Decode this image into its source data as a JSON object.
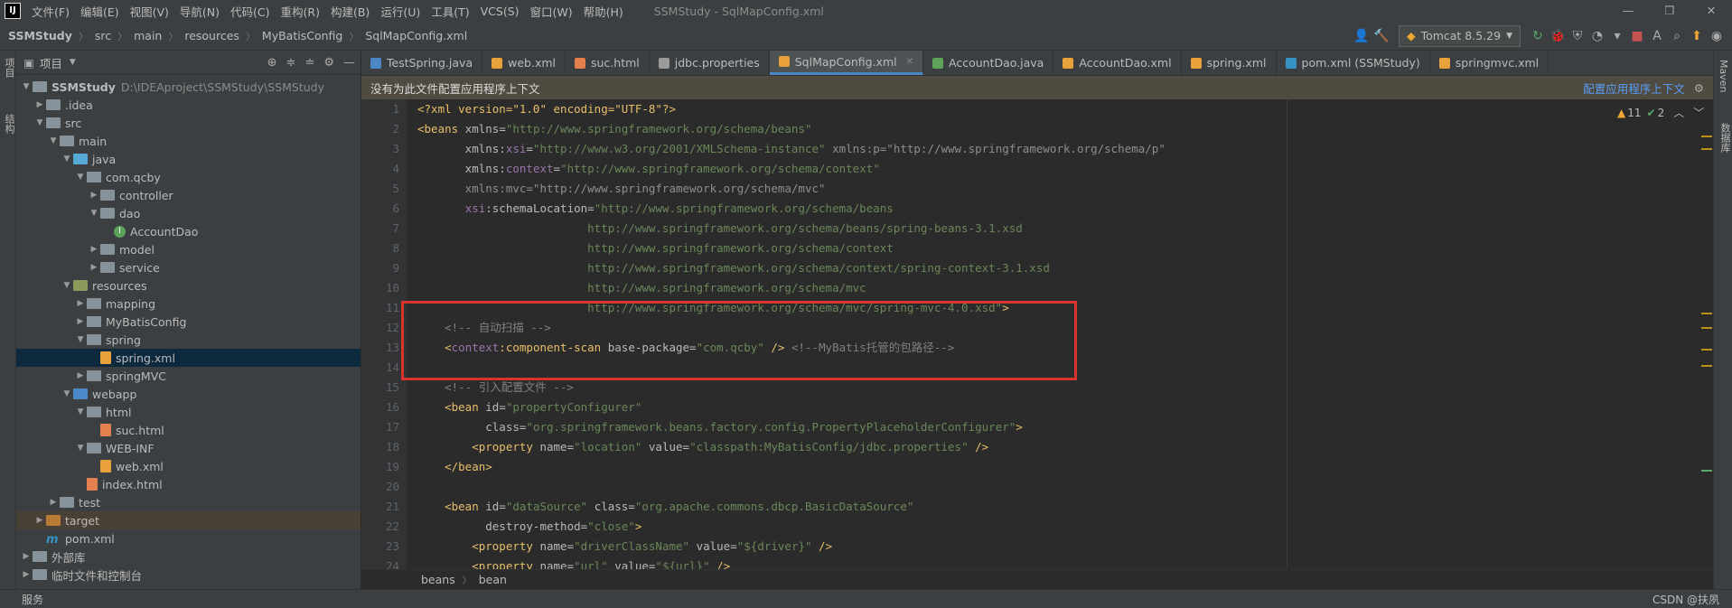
{
  "menubar": {
    "logo": "IJ",
    "items": [
      "文件(F)",
      "编辑(E)",
      "视图(V)",
      "导航(N)",
      "代码(C)",
      "重构(R)",
      "构建(B)",
      "运行(U)",
      "工具(T)",
      "VCS(S)",
      "窗口(W)",
      "帮助(H)"
    ],
    "window_title": "SSMStudy - SqlMapConfig.xml"
  },
  "navbar": {
    "crumbs": [
      "SSMStudy",
      "src",
      "main",
      "resources",
      "MyBatisConfig",
      "SqlMapConfig.xml"
    ],
    "run_config": "Tomcat 8.5.29"
  },
  "left_strip": {
    "project_label": "项目",
    "structure_label": "结构"
  },
  "right_strip": {
    "maven_label": "Maven",
    "db_label": "数据库"
  },
  "project_panel": {
    "title": "项目",
    "tree": [
      {
        "level": 0,
        "arrow": "down",
        "icon": "module",
        "label": "SSMStudy",
        "bold": true,
        "extra": "D:\\IDEAproject\\SSMStudy\\SSMStudy"
      },
      {
        "level": 1,
        "arrow": "right",
        "icon": "folder",
        "label": ".idea"
      },
      {
        "level": 1,
        "arrow": "down",
        "icon": "folder",
        "label": "src"
      },
      {
        "level": 2,
        "arrow": "down",
        "icon": "folder",
        "label": "main"
      },
      {
        "level": 3,
        "arrow": "down",
        "icon": "folder-blue",
        "label": "java"
      },
      {
        "level": 4,
        "arrow": "down",
        "icon": "folder",
        "label": "com.qcby"
      },
      {
        "level": 5,
        "arrow": "right",
        "icon": "folder",
        "label": "controller"
      },
      {
        "level": 5,
        "arrow": "down",
        "icon": "folder",
        "label": "dao"
      },
      {
        "level": 6,
        "arrow": "",
        "icon": "interface",
        "label": "AccountDao"
      },
      {
        "level": 5,
        "arrow": "right",
        "icon": "folder",
        "label": "model"
      },
      {
        "level": 5,
        "arrow": "right",
        "icon": "folder",
        "label": "service"
      },
      {
        "level": 3,
        "arrow": "down",
        "icon": "folder-res",
        "label": "resources"
      },
      {
        "level": 4,
        "arrow": "right",
        "icon": "folder",
        "label": "mapping"
      },
      {
        "level": 4,
        "arrow": "right",
        "icon": "folder",
        "label": "MyBatisConfig"
      },
      {
        "level": 4,
        "arrow": "down",
        "icon": "folder",
        "label": "spring"
      },
      {
        "level": 5,
        "arrow": "",
        "icon": "xml",
        "label": "spring.xml",
        "selected": true
      },
      {
        "level": 4,
        "arrow": "right",
        "icon": "folder",
        "label": "springMVC"
      },
      {
        "level": 3,
        "arrow": "down",
        "icon": "folder-web",
        "label": "webapp"
      },
      {
        "level": 4,
        "arrow": "down",
        "icon": "folder",
        "label": "html"
      },
      {
        "level": 5,
        "arrow": "",
        "icon": "html",
        "label": "suc.html"
      },
      {
        "level": 4,
        "arrow": "down",
        "icon": "folder",
        "label": "WEB-INF"
      },
      {
        "level": 5,
        "arrow": "",
        "icon": "xml",
        "label": "web.xml"
      },
      {
        "level": 4,
        "arrow": "",
        "icon": "html",
        "label": "index.html"
      },
      {
        "level": 2,
        "arrow": "right",
        "icon": "folder",
        "label": "test"
      },
      {
        "level": 1,
        "arrow": "right",
        "icon": "folder-orange",
        "label": "target",
        "excluded": true
      },
      {
        "level": 1,
        "arrow": "",
        "icon": "maven",
        "label": "pom.xml"
      },
      {
        "level": 0,
        "arrow": "right",
        "icon": "lib",
        "label": "外部库"
      },
      {
        "level": 0,
        "arrow": "right",
        "icon": "scratch",
        "label": "临时文件和控制台"
      }
    ]
  },
  "tabs": [
    {
      "label": "TestSpring.java",
      "color": "#4a88c7"
    },
    {
      "label": "web.xml",
      "color": "#e8a13b"
    },
    {
      "label": "suc.html",
      "color": "#e4804d"
    },
    {
      "label": "jdbc.properties",
      "color": "#9a9a9a"
    },
    {
      "label": "SqlMapConfig.xml",
      "color": "#e8a13b",
      "active": true
    },
    {
      "label": "AccountDao.java",
      "color": "#5da35a"
    },
    {
      "label": "AccountDao.xml",
      "color": "#e8a13b"
    },
    {
      "label": "spring.xml",
      "color": "#e8a13b"
    },
    {
      "label": "pom.xml (SSMStudy)",
      "color": "#3592c4"
    },
    {
      "label": "springmvc.xml",
      "color": "#e8a13b"
    }
  ],
  "notification": {
    "text": "没有为此文件配置应用程序上下文",
    "link": "配置应用程序上下文"
  },
  "inspections": {
    "warnings": "11",
    "weak": "2"
  },
  "code_lines": [
    [
      [
        "pi",
        "<?xml version=\"1.0\" encoding=\"UTF-8\"?>"
      ]
    ],
    [
      [
        "tag",
        "<beans "
      ],
      [
        "attr",
        "xmlns="
      ],
      [
        "val",
        "\"http://www.springframework.org/schema/beans\""
      ]
    ],
    [
      [
        "attr",
        "       xmlns:"
      ],
      [
        "ns",
        "xsi"
      ],
      [
        "attr",
        "="
      ],
      [
        "val",
        "\"http://www.w3.org/2001/XMLSchema-instance\" "
      ],
      [
        "dimattr",
        "xmlns:p=\"http://www.springframework.org/schema/p\""
      ]
    ],
    [
      [
        "attr",
        "       xmlns:"
      ],
      [
        "ns",
        "context"
      ],
      [
        "attr",
        "="
      ],
      [
        "val",
        "\"http://www.springframework.org/schema/context\""
      ]
    ],
    [
      [
        "dimattr",
        "       xmlns:mvc=\"http://www.springframework.org/schema/mvc\""
      ]
    ],
    [
      [
        "attr",
        "       "
      ],
      [
        "ns",
        "xsi"
      ],
      [
        "attr",
        ":schemaLocation="
      ],
      [
        "val",
        "\"http://www.springframework.org/schema/beans"
      ]
    ],
    [
      [
        "val",
        "                         http://www.springframework.org/schema/beans/spring-beans-3.1.xsd"
      ]
    ],
    [
      [
        "val",
        "                         http://www.springframework.org/schema/context"
      ]
    ],
    [
      [
        "val",
        "                         http://www.springframework.org/schema/context/spring-context-3.1.xsd"
      ]
    ],
    [
      [
        "val",
        "                         http://www.springframework.org/schema/mvc"
      ]
    ],
    [
      [
        "val",
        "                         http://www.springframework.org/schema/mvc/spring-mvc-4.0.xsd\""
      ],
      [
        "tag",
        ">"
      ]
    ],
    [
      [
        "cmt",
        "    <!-- 自动扫描 -->"
      ]
    ],
    [
      [
        "tag",
        "    <"
      ],
      [
        "ns",
        "context"
      ],
      [
        "tag",
        ":component-scan "
      ],
      [
        "attr",
        "base-package="
      ],
      [
        "val",
        "\"com.qcby\""
      ],
      [
        "tag",
        " /> "
      ],
      [
        "cmt",
        "<!--MyBatis托管的包路径-->"
      ]
    ],
    [
      [
        "cmt",
        ""
      ]
    ],
    [
      [
        "cmt",
        "    <!-- 引入配置文件 -->"
      ]
    ],
    [
      [
        "tag",
        "    <bean "
      ],
      [
        "attr",
        "id="
      ],
      [
        "val",
        "\"propertyConfigurer\""
      ]
    ],
    [
      [
        "attr",
        "          class="
      ],
      [
        "val",
        "\"org.springframework.beans.factory.config.PropertyPlaceholderConfigurer\""
      ],
      [
        "tag",
        ">"
      ]
    ],
    [
      [
        "tag",
        "        <property "
      ],
      [
        "attr",
        "name="
      ],
      [
        "val",
        "\"location\" "
      ],
      [
        "attr",
        "value="
      ],
      [
        "val",
        "\"classpath:MyBatisConfig/jdbc.properties\""
      ],
      [
        "tag",
        " />"
      ]
    ],
    [
      [
        "tag",
        "    </bean>"
      ]
    ],
    [
      [
        "cmt",
        ""
      ]
    ],
    [
      [
        "tag",
        "    <bean "
      ],
      [
        "attr",
        "id="
      ],
      [
        "val",
        "\"dataSource\" "
      ],
      [
        "attr",
        "class="
      ],
      [
        "val",
        "\"org.apache.commons.dbcp.BasicDataSource\""
      ]
    ],
    [
      [
        "attr",
        "          destroy-method="
      ],
      [
        "val",
        "\"close\""
      ],
      [
        "tag",
        ">"
      ]
    ],
    [
      [
        "tag",
        "        <property "
      ],
      [
        "attr",
        "name="
      ],
      [
        "val",
        "\"driverClassName\" "
      ],
      [
        "attr",
        "value="
      ],
      [
        "val",
        "\"${driver}\""
      ],
      [
        "tag",
        " />"
      ]
    ],
    [
      [
        "tag",
        "        <property "
      ],
      [
        "attr",
        "name="
      ],
      [
        "val",
        "\"url\" "
      ],
      [
        "attr",
        "value="
      ],
      [
        "val",
        "\"${url}\""
      ],
      [
        "tag",
        " />"
      ]
    ]
  ],
  "line_numbers": [
    "1",
    "2",
    "3",
    "4",
    "5",
    "6",
    "7",
    "8",
    "9",
    "10",
    "11",
    "12",
    "13",
    "14",
    "15",
    "16",
    "17",
    "18",
    "19",
    "20",
    "21",
    "22",
    "23",
    "24"
  ],
  "editor_crumbs": [
    "beans",
    "bean"
  ],
  "status": {
    "left": "服务",
    "right": "CSDN @扶夙"
  }
}
